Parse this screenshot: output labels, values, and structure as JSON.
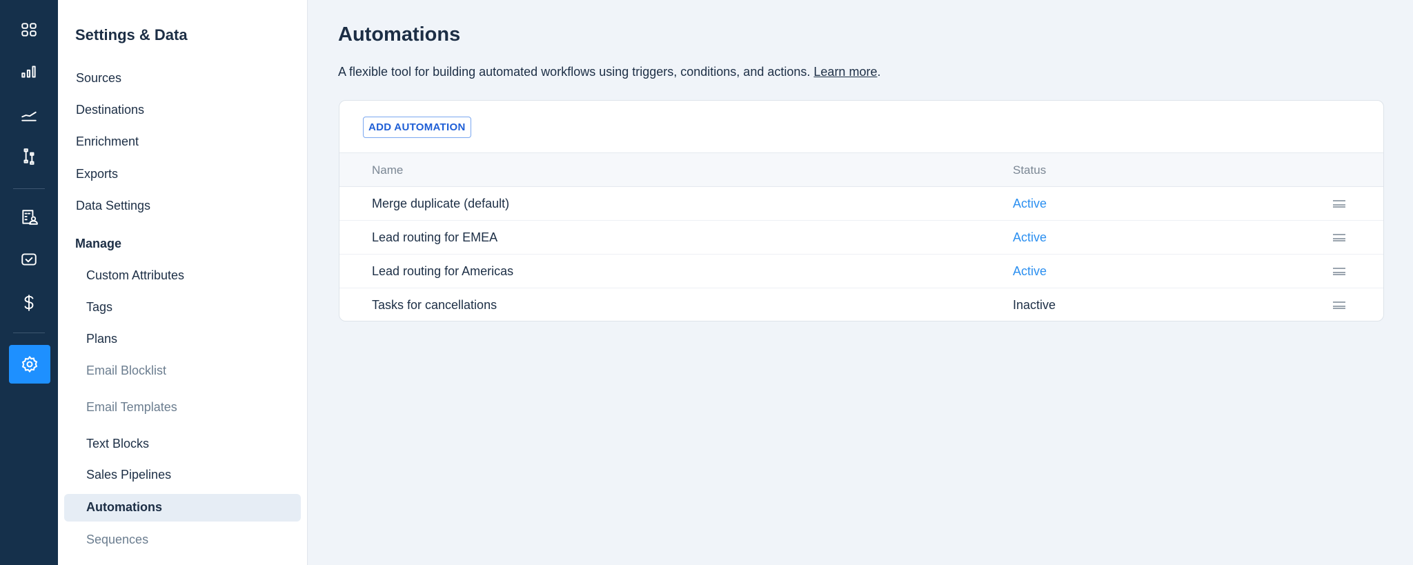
{
  "rail": {
    "icons": [
      "dashboard-icon",
      "bar-chart-icon",
      "trend-icon",
      "pipeline-icon",
      "contacts-icon",
      "tasks-icon",
      "dollar-icon",
      "settings-icon"
    ]
  },
  "sidebar": {
    "title": "Settings & Data",
    "items": [
      "Sources",
      "Destinations",
      "Enrichment",
      "Exports",
      "Data Settings"
    ],
    "manage_heading": "Manage",
    "manage_items": [
      "Custom Attributes",
      "Tags",
      "Plans",
      "Email Blocklist",
      "Email Templates",
      "Text Blocks",
      "Sales Pipelines",
      "Automations",
      "Sequences"
    ],
    "selected": "Automations"
  },
  "main": {
    "title": "Automations",
    "description": "A flexible tool for building automated workflows using triggers, conditions, and actions.",
    "learn_more": "Learn more",
    "period": ".",
    "add_button": "ADD AUTOMATION",
    "columns": [
      "Name",
      "Status"
    ],
    "rows": [
      {
        "name": "Merge duplicate (default)",
        "status": "Active"
      },
      {
        "name": "Lead routing for EMEA",
        "status": "Active"
      },
      {
        "name": "Lead routing for Americas",
        "status": "Active"
      },
      {
        "name": "Tasks for cancellations",
        "status": "Inactive"
      }
    ]
  },
  "colors": {
    "rail": "#15304b",
    "accent": "#1e90ff",
    "active": "#2b8ff0"
  }
}
